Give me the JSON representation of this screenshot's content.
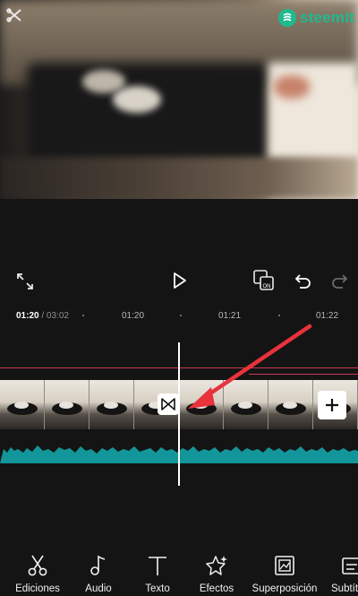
{
  "brand": {
    "name": "steemit",
    "color": "#1fb98e"
  },
  "preview": {
    "description_icon": "scissor-mark-icon"
  },
  "controls": {
    "fullscreen_icon": "fullscreen-icon",
    "play_icon": "play-icon",
    "keyframe_badge": "ON",
    "undo_icon": "undo-icon",
    "redo_icon": "redo-icon"
  },
  "timeline": {
    "current_time": "01:20",
    "total_time": "/ 03:02",
    "marks": [
      "01:20",
      "01:21",
      "01:22"
    ],
    "clip_frames": 8,
    "transition_icon": "bowtie-transition-icon",
    "add_icon": "plus-icon",
    "accent_line_color": "#c9394f",
    "audio_color": "#13969a"
  },
  "toolbar": {
    "items": [
      {
        "label": "Ediciones",
        "icon": "scissors-icon"
      },
      {
        "label": "Audio",
        "icon": "music-note-icon"
      },
      {
        "label": "Texto",
        "icon": "text-icon"
      },
      {
        "label": "Efectos",
        "icon": "effects-star-icon"
      },
      {
        "label": "Superposición",
        "icon": "overlay-icon"
      },
      {
        "label": "Subtít",
        "icon": "subtitles-icon"
      }
    ]
  }
}
